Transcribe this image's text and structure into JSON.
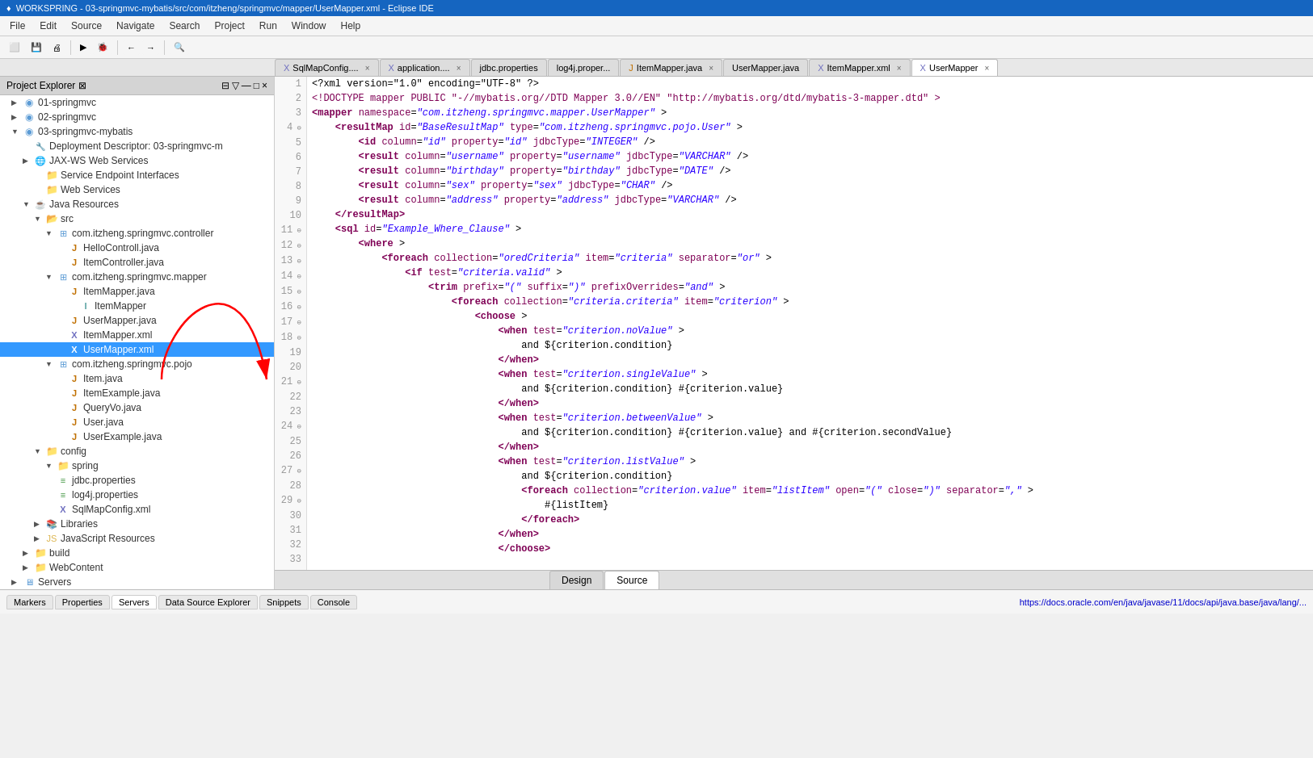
{
  "titleBar": {
    "icon": "♦",
    "title": "WORKSPRING - 03-springmvc-mybatis/src/com/itzheng/springmvc/mapper/UserMapper.xml - Eclipse IDE"
  },
  "menuBar": {
    "items": [
      "File",
      "Edit",
      "Source",
      "Navigate",
      "Search",
      "Project",
      "Run",
      "Window",
      "Help"
    ]
  },
  "editorTabs": [
    {
      "label": "SqlMapConfig....",
      "active": false,
      "icon": "X"
    },
    {
      "label": "application....",
      "active": false,
      "icon": "X"
    },
    {
      "label": "jdbc.properties",
      "active": false,
      "icon": ""
    },
    {
      "label": "log4j.proper...",
      "active": false,
      "icon": ""
    },
    {
      "label": "ItemMapper.java",
      "active": false,
      "icon": "X"
    },
    {
      "label": "UserMapper.java",
      "active": false,
      "icon": ""
    },
    {
      "label": "ItemMapper.xml",
      "active": false,
      "icon": "X"
    },
    {
      "label": "UserMapper",
      "active": true,
      "icon": "X"
    }
  ],
  "sidebar": {
    "title": "Project Explorer",
    "items": [
      {
        "label": "01-springmvc",
        "indent": 1,
        "arrow": "▶",
        "icon": "project",
        "type": "project"
      },
      {
        "label": "02-springmvc",
        "indent": 1,
        "arrow": "▶",
        "icon": "project",
        "type": "project"
      },
      {
        "label": "03-springmvc-mybatis",
        "indent": 1,
        "arrow": "▼",
        "icon": "project",
        "type": "project"
      },
      {
        "label": "Deployment Descriptor: 03-springmvc-m",
        "indent": 2,
        "arrow": "",
        "icon": "deploy"
      },
      {
        "label": "JAX-WS Web Services",
        "indent": 2,
        "arrow": "▶",
        "icon": "webservice"
      },
      {
        "label": "Service Endpoint Interfaces",
        "indent": 3,
        "arrow": "",
        "icon": "folder"
      },
      {
        "label": "Web Services",
        "indent": 3,
        "arrow": "",
        "icon": "folder"
      },
      {
        "label": "Java Resources",
        "indent": 2,
        "arrow": "▼",
        "icon": "javaresources"
      },
      {
        "label": "src",
        "indent": 3,
        "arrow": "▼",
        "icon": "srcfolder"
      },
      {
        "label": "com.itzheng.springmvc.controller",
        "indent": 4,
        "arrow": "▼",
        "icon": "package"
      },
      {
        "label": "HelloControll.java",
        "indent": 5,
        "arrow": "",
        "icon": "java"
      },
      {
        "label": "ItemController.java",
        "indent": 5,
        "arrow": "",
        "icon": "java"
      },
      {
        "label": "com.itzheng.springmvc.mapper",
        "indent": 4,
        "arrow": "▼",
        "icon": "package"
      },
      {
        "label": "ItemMapper.java",
        "indent": 5,
        "arrow": "",
        "icon": "java"
      },
      {
        "label": "ItemMapper",
        "indent": 6,
        "arrow": "",
        "icon": "interface"
      },
      {
        "label": "UserMapper.java",
        "indent": 5,
        "arrow": "",
        "icon": "java"
      },
      {
        "label": "ItemMapper.xml",
        "indent": 5,
        "arrow": "",
        "icon": "xml"
      },
      {
        "label": "UserMapper.xml",
        "indent": 5,
        "arrow": "",
        "icon": "xml",
        "selected": true
      },
      {
        "label": "com.itzheng.springmvc.pojo",
        "indent": 4,
        "arrow": "▼",
        "icon": "package"
      },
      {
        "label": "Item.java",
        "indent": 5,
        "arrow": "",
        "icon": "java"
      },
      {
        "label": "ItemExample.java",
        "indent": 5,
        "arrow": "",
        "icon": "java"
      },
      {
        "label": "QueryVo.java",
        "indent": 5,
        "arrow": "",
        "icon": "java"
      },
      {
        "label": "User.java",
        "indent": 5,
        "arrow": "",
        "icon": "java"
      },
      {
        "label": "UserExample.java",
        "indent": 5,
        "arrow": "",
        "icon": "java"
      },
      {
        "label": "config",
        "indent": 3,
        "arrow": "▼",
        "icon": "folder"
      },
      {
        "label": "spring",
        "indent": 4,
        "arrow": "▼",
        "icon": "folder"
      },
      {
        "label": "jdbc.properties",
        "indent": 4,
        "arrow": "",
        "icon": "props"
      },
      {
        "label": "log4j.properties",
        "indent": 4,
        "arrow": "",
        "icon": "props"
      },
      {
        "label": "SqlMapConfig.xml",
        "indent": 4,
        "arrow": "",
        "icon": "xml"
      },
      {
        "label": "Libraries",
        "indent": 3,
        "arrow": "▶",
        "icon": "libs"
      },
      {
        "label": "JavaScript Resources",
        "indent": 3,
        "arrow": "▶",
        "icon": "jsres"
      },
      {
        "label": "build",
        "indent": 2,
        "arrow": "▶",
        "icon": "folder"
      },
      {
        "label": "WebContent",
        "indent": 2,
        "arrow": "▶",
        "icon": "folder"
      },
      {
        "label": "Servers",
        "indent": 1,
        "arrow": "▶",
        "icon": "servers"
      }
    ]
  },
  "codeLines": [
    {
      "num": "1",
      "content": "<?xml version=\"1.0\" encoding=\"UTF-8\" ?>"
    },
    {
      "num": "2",
      "content": "<!DOCTYPE mapper PUBLIC \"-//mybatis.org//DTD Mapper 3.0//EN\" \"http://mybatis.org/dtd/mybatis-3-mapper.dtd\" >"
    },
    {
      "num": "3",
      "content": "<mapper namespace=\"com.itzheng.springmvc.mapper.UserMapper\" >"
    },
    {
      "num": "4",
      "content": "    <resultMap id=\"BaseResultMap\" type=\"com.itzheng.springmvc.pojo.User\" >",
      "fold": true
    },
    {
      "num": "5",
      "content": "        <id column=\"id\" property=\"id\" jdbcType=\"INTEGER\" />"
    },
    {
      "num": "6",
      "content": "        <result column=\"username\" property=\"username\" jdbcType=\"VARCHAR\" />"
    },
    {
      "num": "7",
      "content": "        <result column=\"birthday\" property=\"birthday\" jdbcType=\"DATE\" />"
    },
    {
      "num": "8",
      "content": "        <result column=\"sex\" property=\"sex\" jdbcType=\"CHAR\" />"
    },
    {
      "num": "9",
      "content": "        <result column=\"address\" property=\"address\" jdbcType=\"VARCHAR\" />"
    },
    {
      "num": "10",
      "content": "    </resultMap>"
    },
    {
      "num": "11",
      "content": "    <sql id=\"Example_Where_Clause\" >",
      "fold": true
    },
    {
      "num": "12",
      "content": "        <where >",
      "fold": true
    },
    {
      "num": "13",
      "content": "            <foreach collection=\"oredCriteria\" item=\"criteria\" separator=\"or\" >",
      "fold": true
    },
    {
      "num": "14",
      "content": "                <if test=\"criteria.valid\" >",
      "fold": true
    },
    {
      "num": "15",
      "content": "                    <trim prefix=\"(\" suffix=\")\" prefixOverrides=\"and\" >",
      "fold": true
    },
    {
      "num": "16",
      "content": "                        <foreach collection=\"criteria.criteria\" item=\"criterion\" >",
      "fold": true
    },
    {
      "num": "17",
      "content": "                            <choose >",
      "fold": true
    },
    {
      "num": "18",
      "content": "                                <when test=\"criterion.noValue\" >",
      "fold": true
    },
    {
      "num": "19",
      "content": "                                    and ${criterion.condition}"
    },
    {
      "num": "20",
      "content": "                                </when>"
    },
    {
      "num": "21",
      "content": "                                <when test=\"criterion.singleValue\" >",
      "fold": true
    },
    {
      "num": "22",
      "content": "                                    and ${criterion.condition} #{criterion.value}"
    },
    {
      "num": "23",
      "content": "                                </when>"
    },
    {
      "num": "24",
      "content": "                                <when test=\"criterion.betweenValue\" >",
      "fold": true
    },
    {
      "num": "25",
      "content": "                                    and ${criterion.condition} #{criterion.value} and #{criterion.secondValue}"
    },
    {
      "num": "26",
      "content": "                                </when>"
    },
    {
      "num": "27",
      "content": "                                <when test=\"criterion.listValue\" >",
      "fold": true
    },
    {
      "num": "28",
      "content": "                                    and ${criterion.condition}"
    },
    {
      "num": "29",
      "content": "                                    <foreach collection=\"criterion.value\" item=\"listItem\" open=\"(\" close=\")\" separator=\",\" >",
      "fold": true
    },
    {
      "num": "30",
      "content": "                                        #{listItem}"
    },
    {
      "num": "31",
      "content": "                                    </foreach>"
    },
    {
      "num": "32",
      "content": "                                </when>"
    },
    {
      "num": "33",
      "content": "                                </choose>"
    }
  ],
  "designSourceTabs": [
    {
      "label": "Design",
      "active": false
    },
    {
      "label": "Source",
      "active": true
    }
  ],
  "bottomPanelTabs": [
    {
      "label": "Markers"
    },
    {
      "label": "Properties"
    },
    {
      "label": "Servers"
    },
    {
      "label": "Data Source Explorer"
    },
    {
      "label": "Snippets"
    },
    {
      "label": "Console"
    }
  ],
  "statusBar": {
    "text": "https://docs.oracle.com/en/java/javase/11/docs/api/java.base/java/lang/..."
  }
}
